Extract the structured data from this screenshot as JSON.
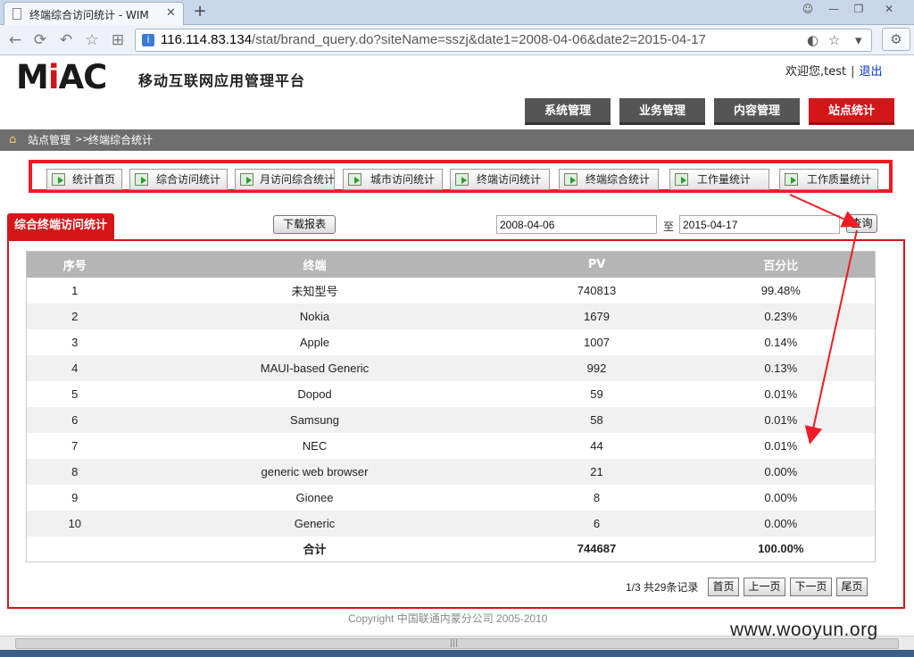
{
  "browser": {
    "tab_title": "终端综合访问统计 - WIM",
    "url_host": "116.114.83.134",
    "url_path": "/stat/brand_query.do?siteName=sszj&date1=2008-04-06&date2=2015-04-17"
  },
  "header": {
    "logo_part1": "M",
    "logo_i": "i",
    "logo_part2": "AC",
    "platform": "移动互联网应用管理平台",
    "welcome": "欢迎您,test",
    "separator": "|",
    "logout": "退出"
  },
  "topnav": [
    "系统管理",
    "业务管理",
    "内容管理",
    "站点统计"
  ],
  "breadcrumb": {
    "root": "站点管理",
    "arrow": ">>",
    "current": "终端综合统计"
  },
  "subnav": [
    "统计首页",
    "综合访问统计",
    "月访问综合统计",
    "城市访问统计",
    "终端访问统计",
    "终端综合统计",
    "工作量统计",
    "工作质量统计"
  ],
  "section": {
    "title": "综合终端访问统计",
    "download_label": "下载报表",
    "date_from": "2008-04-06",
    "date_to_label": "至",
    "date_to": "2015-04-17",
    "query_label": "查询"
  },
  "table": {
    "columns": [
      "序号",
      "终端",
      "PV",
      "百分比"
    ],
    "rows": [
      [
        "1",
        "未知型号",
        "740813",
        "99.48%"
      ],
      [
        "2",
        "Nokia",
        "1679",
        "0.23%"
      ],
      [
        "3",
        "Apple",
        "1007",
        "0.14%"
      ],
      [
        "4",
        "MAUI-based Generic",
        "992",
        "0.13%"
      ],
      [
        "5",
        "Dopod",
        "59",
        "0.01%"
      ],
      [
        "6",
        "Samsung",
        "58",
        "0.01%"
      ],
      [
        "7",
        "NEC",
        "44",
        "0.01%"
      ],
      [
        "8",
        "generic web browser",
        "21",
        "0.00%"
      ],
      [
        "9",
        "Gionee",
        "8",
        "0.00%"
      ],
      [
        "10",
        "Generic",
        "6",
        "0.00%"
      ]
    ],
    "total": [
      "",
      "合计",
      "744687",
      "100.00%"
    ]
  },
  "pager": {
    "info": "1/3 共29条记录",
    "first": "首页",
    "prev": "上一页",
    "next": "下一页",
    "last": "尾页"
  },
  "footer": {
    "copyright": "Copyright 中国联通内蒙分公司 2005-2010",
    "watermark": "www.wooyun.org"
  },
  "colors": {
    "accent_red": "#d51619",
    "annotation_red": "#ee1c24",
    "nav_gray": "#555555"
  }
}
